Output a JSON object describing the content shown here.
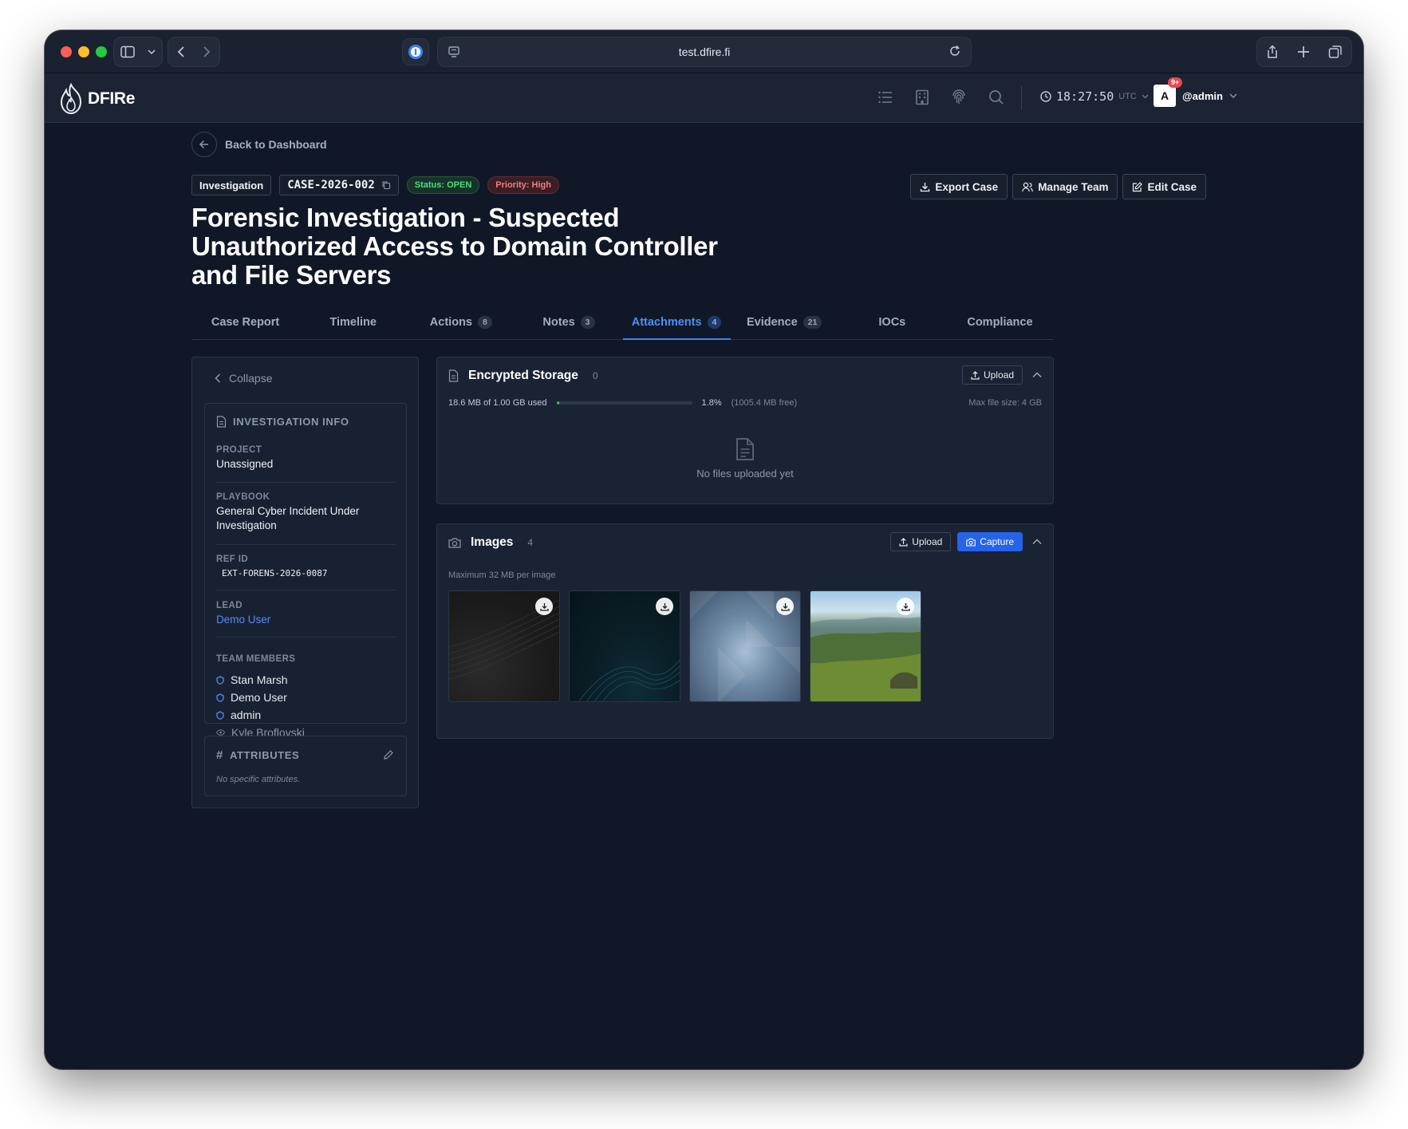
{
  "browser": {
    "url": "test.dfire.fi"
  },
  "header": {
    "brand": "DFIRe",
    "time": "18:27:50",
    "timezone": "UTC",
    "notification_count": "9+",
    "avatar_initial": "A",
    "username": "@admin"
  },
  "nav": {
    "back_label": "Back to Dashboard"
  },
  "case": {
    "type": "Investigation",
    "id": "CASE-2026-002",
    "status": "Status: OPEN",
    "priority": "Priority: High",
    "title": "Forensic Investigation - Suspected Unauthorized Access to Domain Controller and File Servers"
  },
  "actions": {
    "export": "Export Case",
    "manage_team": "Manage Team",
    "edit": "Edit Case"
  },
  "tabs": [
    {
      "label": "Case Report",
      "count": ""
    },
    {
      "label": "Timeline",
      "count": ""
    },
    {
      "label": "Actions",
      "count": "8"
    },
    {
      "label": "Notes",
      "count": "3"
    },
    {
      "label": "Attachments",
      "count": "4"
    },
    {
      "label": "Evidence",
      "count": "21"
    },
    {
      "label": "IOCs",
      "count": ""
    },
    {
      "label": "Compliance",
      "count": ""
    }
  ],
  "sidebar": {
    "collapse_label": "Collapse",
    "info_heading": "INVESTIGATION INFO",
    "project_label": "PROJECT",
    "project_value": "Unassigned",
    "playbook_label": "PLAYBOOK",
    "playbook_value": "General Cyber Incident Under Investigation",
    "refid_label": "REF ID",
    "refid_value": "EXT-FORENS-2026-0087",
    "lead_label": "LEAD",
    "lead_value": "Demo User",
    "team_label": "TEAM MEMBERS",
    "members": [
      {
        "name": "Stan Marsh",
        "role": "member"
      },
      {
        "name": "Demo User",
        "role": "member"
      },
      {
        "name": "admin",
        "role": "member"
      },
      {
        "name": "Kyle Broflovski",
        "role": "viewer"
      }
    ],
    "attributes_heading": "ATTRIBUTES",
    "attributes_empty": "No specific attributes."
  },
  "storage": {
    "title": "Encrypted Storage",
    "count": "0",
    "upload_label": "Upload",
    "used_text": "18.6 MB of 1.00 GB used",
    "percent_text": "1.8%",
    "usage_fraction": 0.018,
    "free_text": "(1005.4 MB free)",
    "max_file": "Max file size: 4 GB",
    "empty_text": "No files uploaded yet"
  },
  "images": {
    "title": "Images",
    "count": "4",
    "upload_label": "Upload",
    "capture_label": "Capture",
    "max_text": "Maximum 32 MB per image"
  },
  "colors": {
    "accent": "#3b82f6",
    "status_open": "#4ade80",
    "priority_high": "#f47c85",
    "storage_bar": "#22c55e"
  }
}
